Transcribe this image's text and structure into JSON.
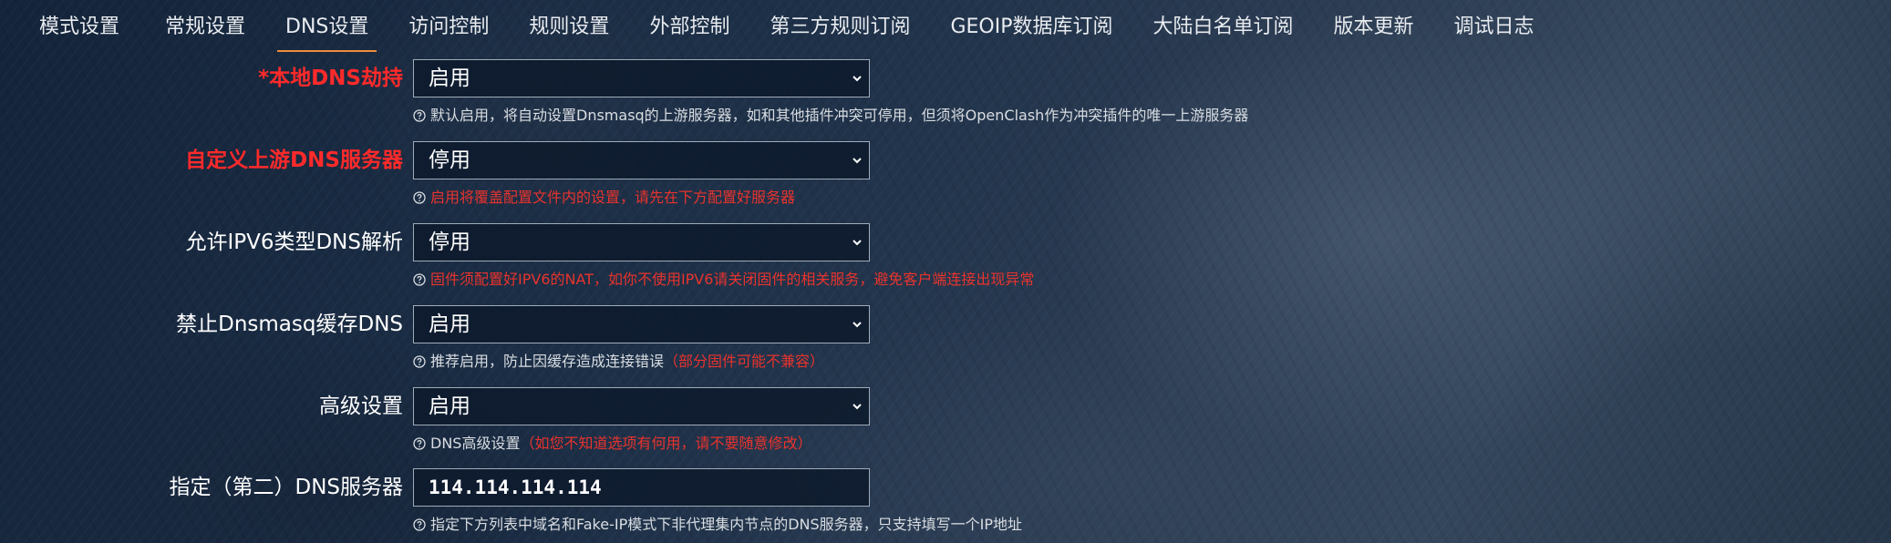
{
  "tabs": [
    {
      "label": "模式设置",
      "active": false
    },
    {
      "label": "常规设置",
      "active": false
    },
    {
      "label": "DNS设置",
      "active": true
    },
    {
      "label": "访问控制",
      "active": false
    },
    {
      "label": "规则设置",
      "active": false
    },
    {
      "label": "外部控制",
      "active": false
    },
    {
      "label": "第三方规则订阅",
      "active": false
    },
    {
      "label": "GEOIP数据库订阅",
      "active": false
    },
    {
      "label": "大陆白名单订阅",
      "active": false
    },
    {
      "label": "版本更新",
      "active": false
    },
    {
      "label": "调试日志",
      "active": false
    }
  ],
  "fields": {
    "local_dns_hijack": {
      "label": "*本地DNS劫持",
      "value": "启用",
      "help": "默认启用，将自动设置Dnsmasq的上游服务器，如和其他插件冲突可停用，但须将OpenClash作为冲突插件的唯一上游服务器",
      "help_red": ""
    },
    "custom_upstream_dns": {
      "label": "自定义上游DNS服务器",
      "value": "停用",
      "help": "",
      "help_red": "启用将覆盖配置文件内的设置，请先在下方配置好服务器"
    },
    "ipv6_dns": {
      "label": "允许IPV6类型DNS解析",
      "value": "停用",
      "help": "",
      "help_red": "固件须配置好IPV6的NAT，如你不使用IPV6请关闭固件的相关服务，避免客户端连接出现异常"
    },
    "disable_dnsmasq_cache": {
      "label": "禁止Dnsmasq缓存DNS",
      "value": "启用",
      "help": "推荐启用，防止因缓存造成连接错误",
      "help_red": "（部分固件可能不兼容）"
    },
    "advanced_settings": {
      "label": "高级设置",
      "value": "启用",
      "help": "DNS高级设置",
      "help_red": "（如您不知道选项有何用，请不要随意修改）"
    },
    "secondary_dns": {
      "label": "指定（第二）DNS服务器",
      "value": "114.114.114.114",
      "help": "指定下方列表中域名和Fake-IP模式下非代理集内节点的DNS服务器，只支持填写一个IP地址",
      "help_red": ""
    }
  },
  "colors": {
    "accent": "#f08b3c",
    "required_label": "#ff2a2a",
    "warning_text": "#e8332d"
  },
  "icons": {
    "help": "question-circle-icon",
    "select_arrow": "chevron-down-icon"
  }
}
